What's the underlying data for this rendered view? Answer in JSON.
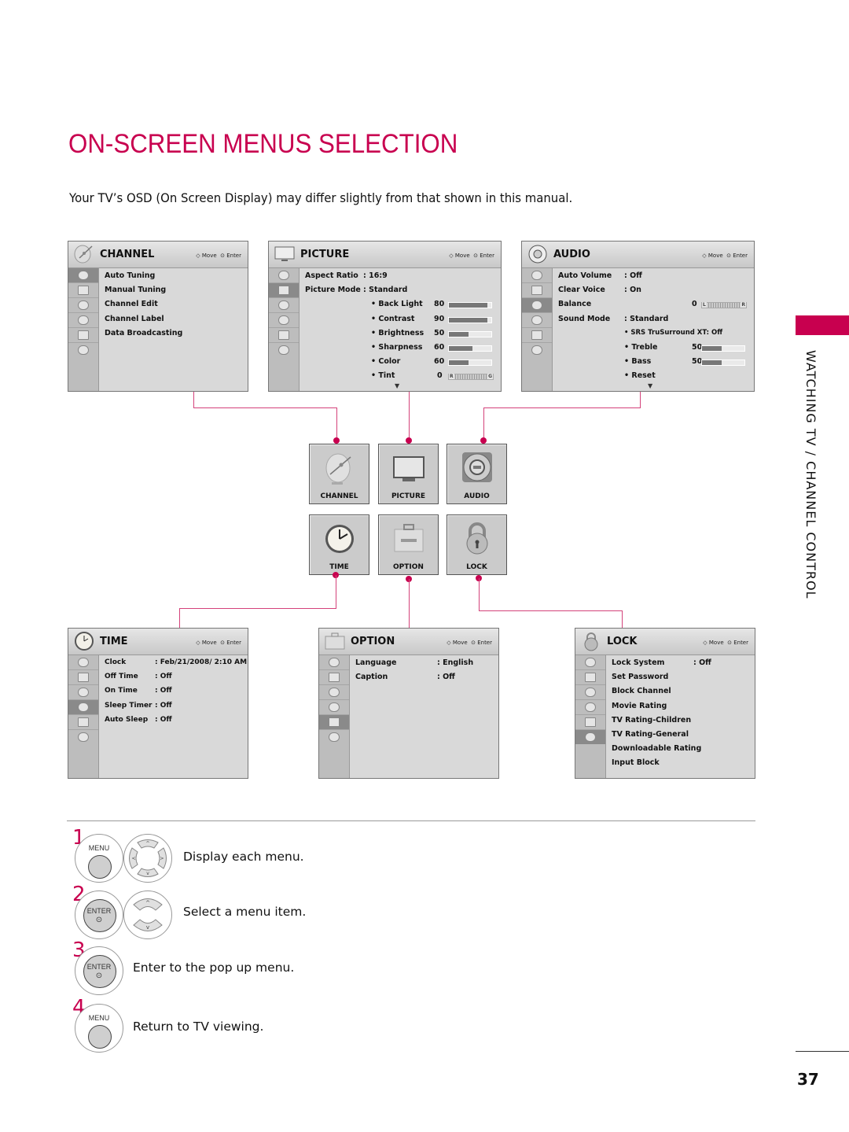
{
  "page": {
    "title": "ON-SCREEN MENUS SELECTION",
    "subtitle": "Your TV’s OSD (On Screen Display) may differ slightly from that shown in this manual.",
    "section_label": "WATCHING TV / CHANNEL CONTROL",
    "page_number": "37",
    "accent_color": "#c8004f"
  },
  "hint": {
    "move": "Move",
    "enter": "Enter"
  },
  "menus": {
    "channel": {
      "title": "CHANNEL",
      "items": [
        "Auto Tuning",
        "Manual Tuning",
        "Channel Edit",
        "Channel Label",
        "Data Broadcasting"
      ]
    },
    "picture": {
      "title": "PICTURE",
      "aspect_ratio": {
        "label": "Aspect Ratio",
        "value": ": 16:9"
      },
      "picture_mode": {
        "label": "Picture Mode",
        "value": ": Standard"
      },
      "sliders": [
        {
          "label": "• Back Light",
          "value": "80",
          "percent": 90
        },
        {
          "label": "• Contrast",
          "value": "90",
          "percent": 90
        },
        {
          "label": "• Brightness",
          "value": "50",
          "percent": 47
        },
        {
          "label": "• Sharpness",
          "value": "60",
          "percent": 55
        },
        {
          "label": "• Color",
          "value": "60",
          "percent": 47
        }
      ],
      "tint": {
        "label": "• Tint",
        "value": "0",
        "left": "R",
        "right": "G"
      }
    },
    "audio": {
      "title": "AUDIO",
      "auto_volume": {
        "label": "Auto Volume",
        "value": ": Off"
      },
      "clear_voice": {
        "label": "Clear Voice",
        "value": ": On"
      },
      "balance": {
        "label": "Balance",
        "value": "0",
        "left": "L",
        "right": "R"
      },
      "sound_mode": {
        "label": "Sound Mode",
        "value": ": Standard"
      },
      "srs": "• SRS TruSurround XT:  Off",
      "treble": {
        "label": "• Treble",
        "value": "50",
        "percent": 47
      },
      "bass": {
        "label": "• Bass",
        "value": "50",
        "percent": 47
      },
      "reset": "• Reset"
    },
    "time": {
      "title": "TIME",
      "items": [
        {
          "label": "Clock",
          "value": ": Feb/21/2008/  2:10 AM"
        },
        {
          "label": "Off Time",
          "value": ": Off"
        },
        {
          "label": "On Time",
          "value": ": Off"
        },
        {
          "label": "Sleep Timer",
          "value": ": Off"
        },
        {
          "label": "Auto Sleep",
          "value": ": Off"
        }
      ]
    },
    "option": {
      "title": "OPTION",
      "items": [
        {
          "label": "Language",
          "value": ": English"
        },
        {
          "label": "Caption",
          "value": ": Off"
        }
      ]
    },
    "lock": {
      "title": "LOCK",
      "items": [
        {
          "label": "Lock System",
          "value": ": Off"
        },
        {
          "label": "Set Password",
          "value": ""
        },
        {
          "label": "Block Channel",
          "value": ""
        },
        {
          "label": "Movie Rating",
          "value": ""
        },
        {
          "label": "TV Rating-Children",
          "value": ""
        },
        {
          "label": "TV Rating-General",
          "value": ""
        },
        {
          "label": "Downloadable Rating",
          "value": ""
        },
        {
          "label": "Input Block",
          "value": ""
        }
      ]
    }
  },
  "tiles": [
    "CHANNEL",
    "PICTURE",
    "AUDIO",
    "TIME",
    "OPTION",
    "LOCK"
  ],
  "steps": [
    {
      "num": "1",
      "button": "MENU",
      "text": "Display each menu."
    },
    {
      "num": "2",
      "button": "ENTER",
      "text": "Select a menu item."
    },
    {
      "num": "3",
      "button": "ENTER",
      "text": "Enter to the pop up menu."
    },
    {
      "num": "4",
      "button": "MENU",
      "text": "Return to TV viewing."
    }
  ]
}
